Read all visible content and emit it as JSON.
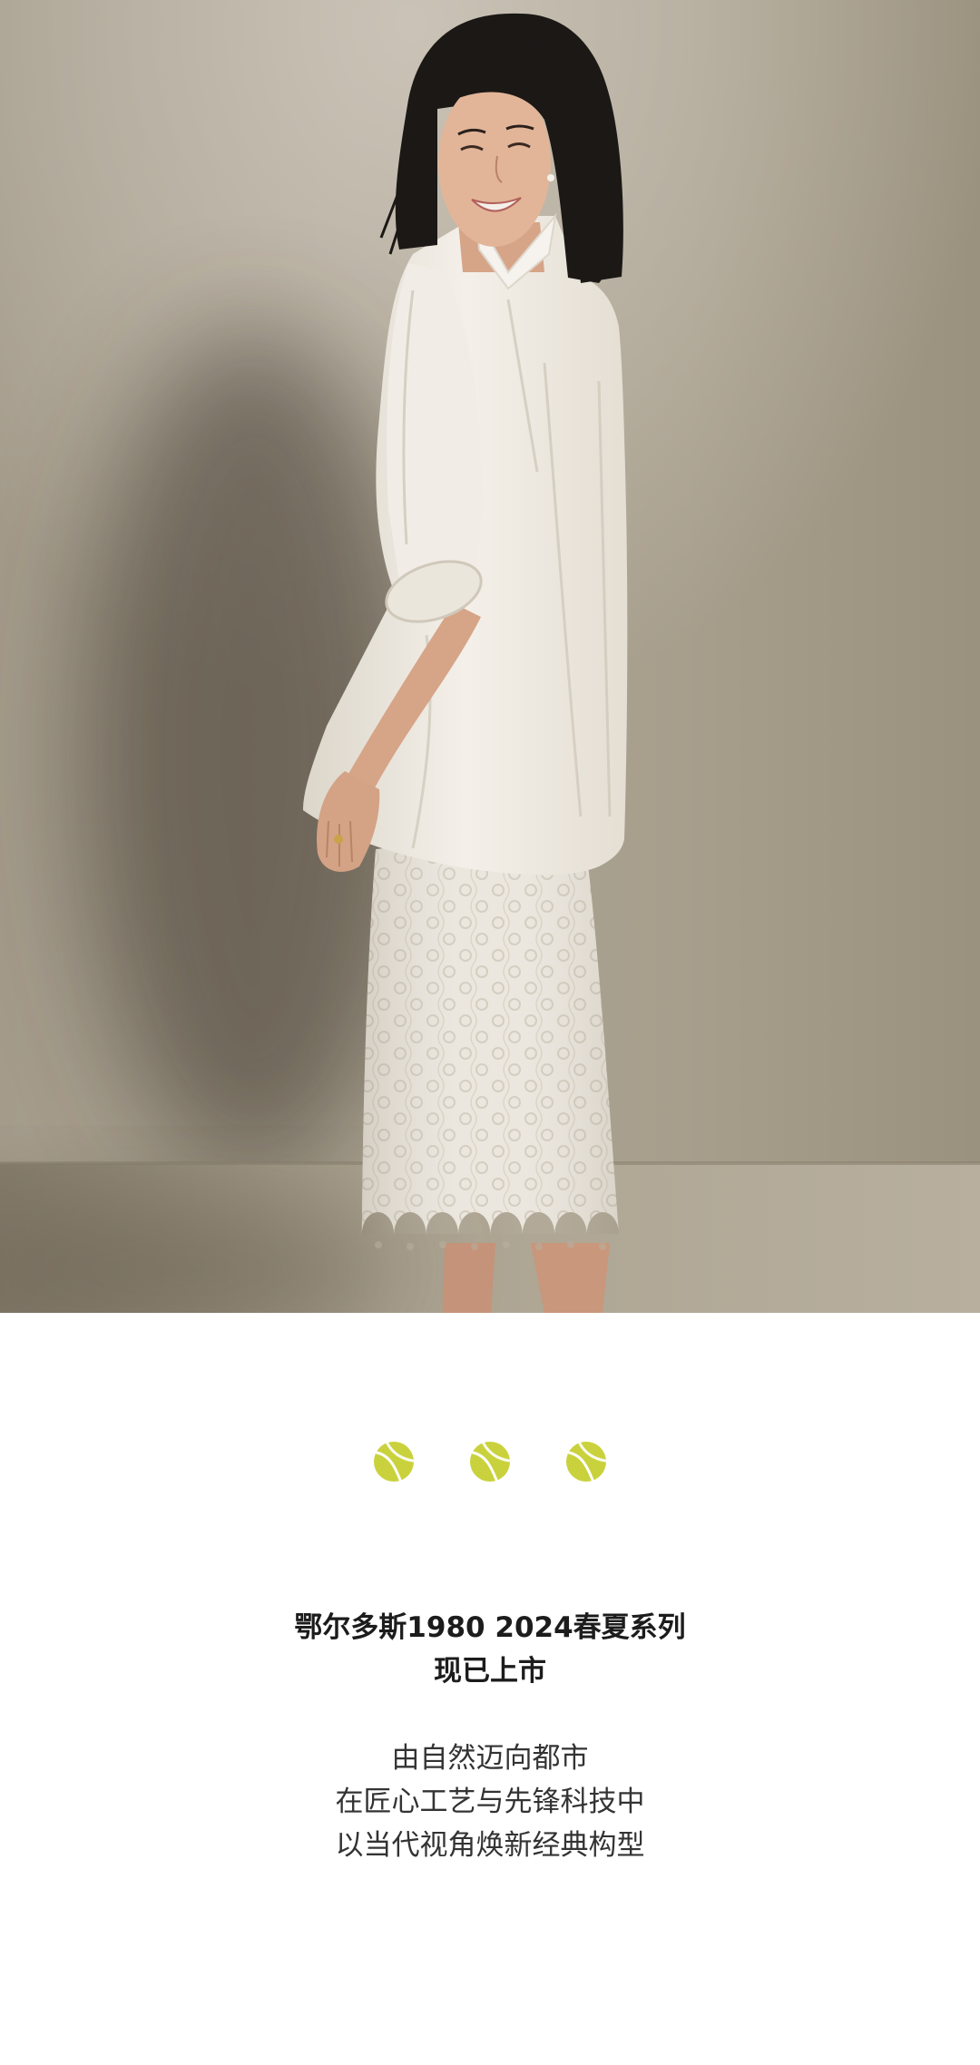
{
  "colors": {
    "background": "#ffffff",
    "headline_text": "#1c1c1c",
    "body_text": "#333333",
    "ball": "#c9d23c"
  },
  "divider": {
    "icons": [
      "tennis-ball-icon",
      "tennis-ball-icon",
      "tennis-ball-icon"
    ]
  },
  "headline": {
    "line1": "鄂尔多斯1980 2024春夏系列",
    "line2": "现已上市"
  },
  "body": {
    "lines": [
      "由自然迈向都市",
      "在匠心工艺与先锋科技中",
      "以当代视角焕新经典构型"
    ]
  }
}
